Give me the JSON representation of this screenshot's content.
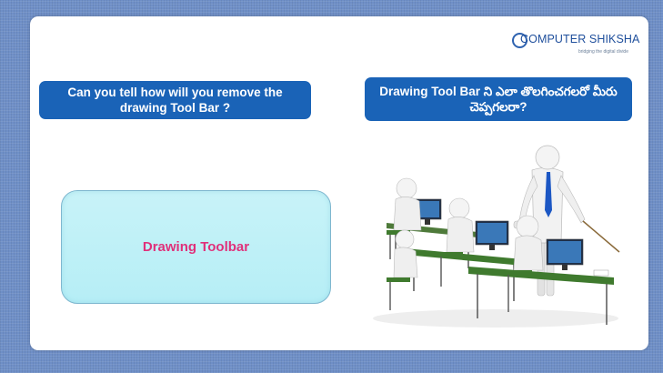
{
  "logo": {
    "brand": "COMPUTER SHIKSHA",
    "tagline": "bridging the digital divide",
    "brand_color": "#1f4f9c"
  },
  "question_english": "Can you tell how will you remove the drawing Tool Bar ?",
  "question_telugu": "Drawing Tool Bar ని ఎలా తొలగించగలరో మీరు చెప్పగలరా?",
  "answer": "Drawing Toolbar",
  "colors": {
    "question_box": "#1a63b7",
    "answer_box": "#c0f1f7",
    "answer_text": "#e0307a",
    "background": "#6f8fc7"
  },
  "illustration": {
    "icon": "classroom-computers-illustration"
  }
}
